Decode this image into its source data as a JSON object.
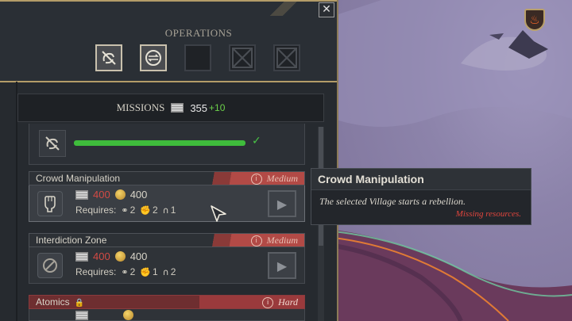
{
  "operations": {
    "title": "OPERATIONS",
    "slots": [
      {
        "icon": "cancel-swirl-icon",
        "state": "active"
      },
      {
        "icon": "coin-swap-icon",
        "state": "active"
      },
      {
        "icon": "empty-slot",
        "state": "empty"
      },
      {
        "icon": "locked-slot-icon",
        "state": "locked"
      },
      {
        "icon": "locked-slot-icon",
        "state": "locked"
      }
    ]
  },
  "close_label": "✕",
  "missions": {
    "label": "MISSIONS",
    "count": "355",
    "income": "+10"
  },
  "active_mission": {
    "progress": 1.0,
    "check": "✓"
  },
  "mission_list": [
    {
      "name": "Crowd Manipulation",
      "difficulty": "Medium",
      "cost_resource": "400",
      "cost_gold": "400",
      "requires_label": "Requires:",
      "requirements": [
        {
          "icon": "link-icon",
          "value": "2"
        },
        {
          "icon": "fist-icon",
          "value": "2"
        },
        {
          "icon": "magnet-icon",
          "value": "1"
        }
      ]
    },
    {
      "name": "Interdiction Zone",
      "difficulty": "Medium",
      "cost_resource": "400",
      "cost_gold": "400",
      "requires_label": "Requires:",
      "requirements": [
        {
          "icon": "link-icon",
          "value": "2"
        },
        {
          "icon": "fist-icon",
          "value": "1"
        },
        {
          "icon": "magnet-icon",
          "value": "2"
        }
      ]
    },
    {
      "name": "Atomics",
      "difficulty": "Hard",
      "locked": true
    }
  ],
  "tooltip": {
    "title": "Crowd Manipulation",
    "description": "The selected Village starts a rebellion.",
    "warning": "Missing resources."
  },
  "colors": {
    "accent_gold": "#b49c68",
    "progress_green": "#3fbc3c",
    "cost_red": "#d24a44",
    "warning_red": "#e2453d",
    "income_green": "#6cd04a"
  }
}
